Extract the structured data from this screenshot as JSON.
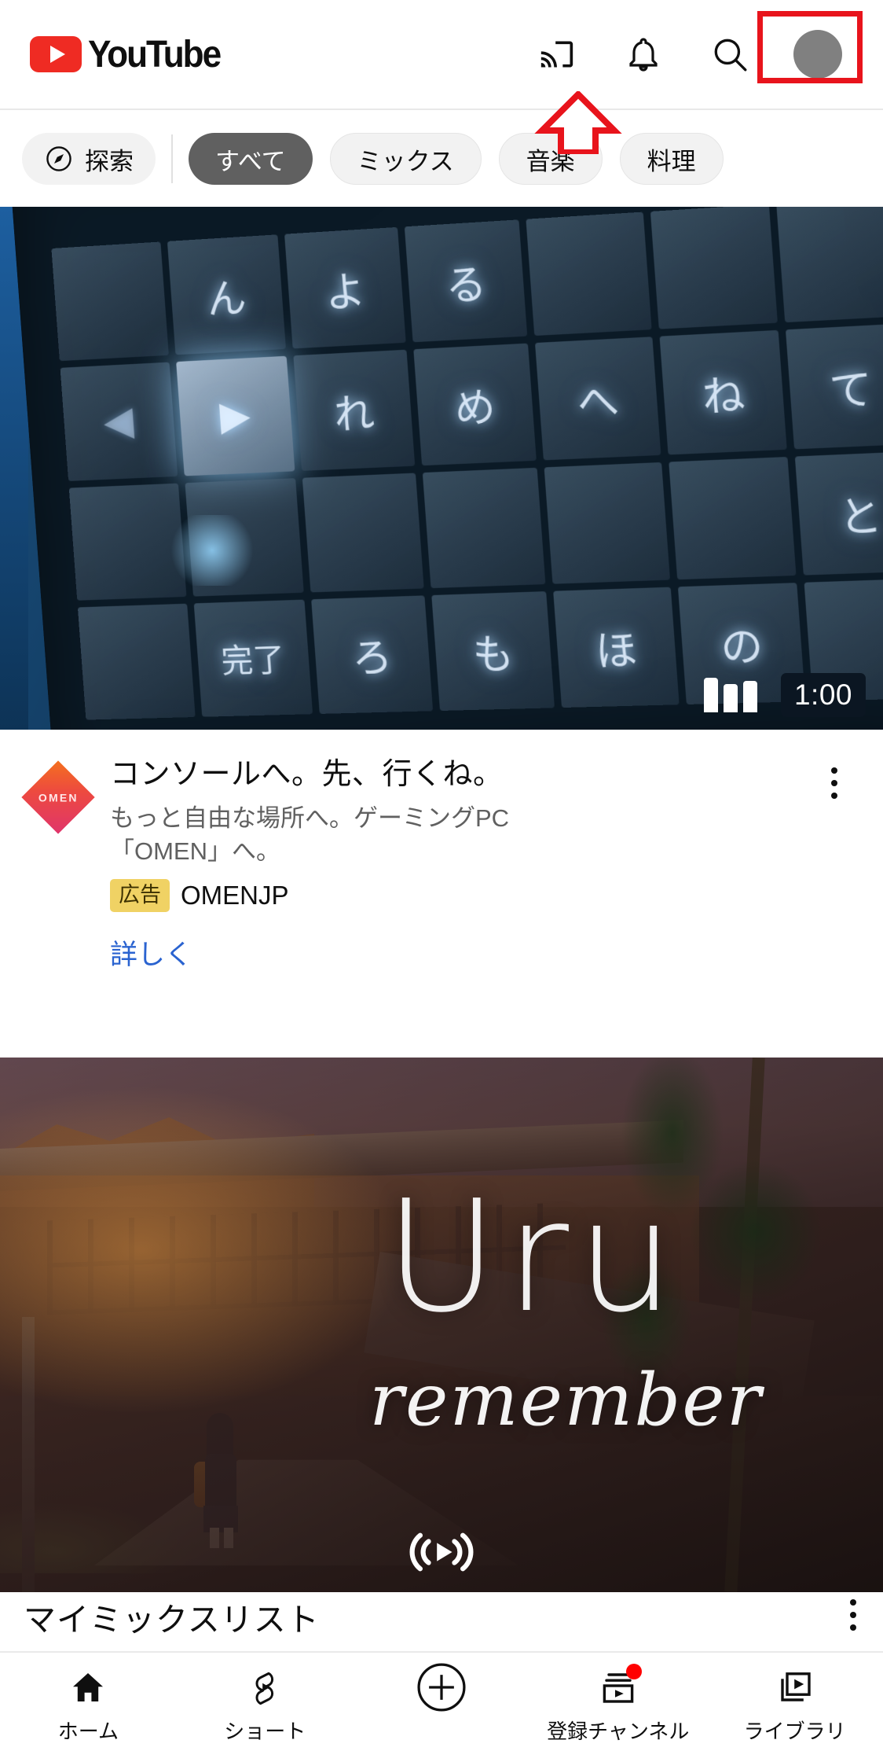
{
  "app": {
    "name": "YouTube",
    "platform": "mobile"
  },
  "topbar": {
    "logo_text": "YouTube",
    "logo_color": "#ef2b23",
    "actions": [
      {
        "name": "cast-icon",
        "label": "キャスト"
      },
      {
        "name": "bell-icon",
        "label": "通知"
      },
      {
        "name": "search-icon",
        "label": "検索"
      },
      {
        "name": "avatar",
        "label": "アカウント",
        "color": "#808080"
      }
    ]
  },
  "chipbar": {
    "explore": {
      "label": "探索",
      "icon": "compass-icon"
    },
    "chips": [
      {
        "label": "すべて",
        "selected": true
      },
      {
        "label": "ミックス",
        "selected": false
      },
      {
        "label": "音楽",
        "selected": false
      },
      {
        "label": "料理",
        "selected": false
      }
    ],
    "selected_bg": "#606060",
    "unselected_bg": "#f2f2f2"
  },
  "feed": {
    "ad_card": {
      "thumbnail_alt": "日本語キーボードのクローズアップ（青い背景）",
      "duration": "1:00",
      "has_bars_indicator": true,
      "channel_logo_text": "OMEN",
      "title": "コンソールへ。先、行くね。",
      "description": "もっと自由な場所へ。ゲーミングPC\n「OMEN」へ。",
      "ad_badge": "広告",
      "channel": "OMENJP",
      "cta": "詳しく",
      "cta_color": "#2a63d0",
      "badge_bg": "#f0d264",
      "menu": "その他"
    },
    "music_card": {
      "thumbnail_alt": "アニメ風イラスト：夕暮れの校舎を歩く女子生徒",
      "artist_title": "Uru",
      "song_title": "remember",
      "live_icon": "radio-live-icon"
    },
    "section": {
      "title": "マイミックスリスト",
      "menu": "その他"
    }
  },
  "bottomnav": {
    "items": [
      {
        "label": "ホーム",
        "icon": "home-icon",
        "active": true,
        "badge": false
      },
      {
        "label": "ショート",
        "icon": "shorts-icon",
        "active": false,
        "badge": false
      },
      {
        "label": "",
        "icon": "create-plus-icon",
        "active": false,
        "badge": false
      },
      {
        "label": "登録チャンネル",
        "icon": "subscriptions-icon",
        "active": false,
        "badge": true
      },
      {
        "label": "ライブラリ",
        "icon": "library-icon",
        "active": false,
        "badge": false
      }
    ],
    "badge_color": "#ff0000"
  },
  "annotations": {
    "highlight_box": {
      "target": "avatar",
      "color": "#e8141c"
    },
    "arrow": {
      "direction": "up",
      "target": "avatar",
      "color": "#e8141c"
    }
  }
}
